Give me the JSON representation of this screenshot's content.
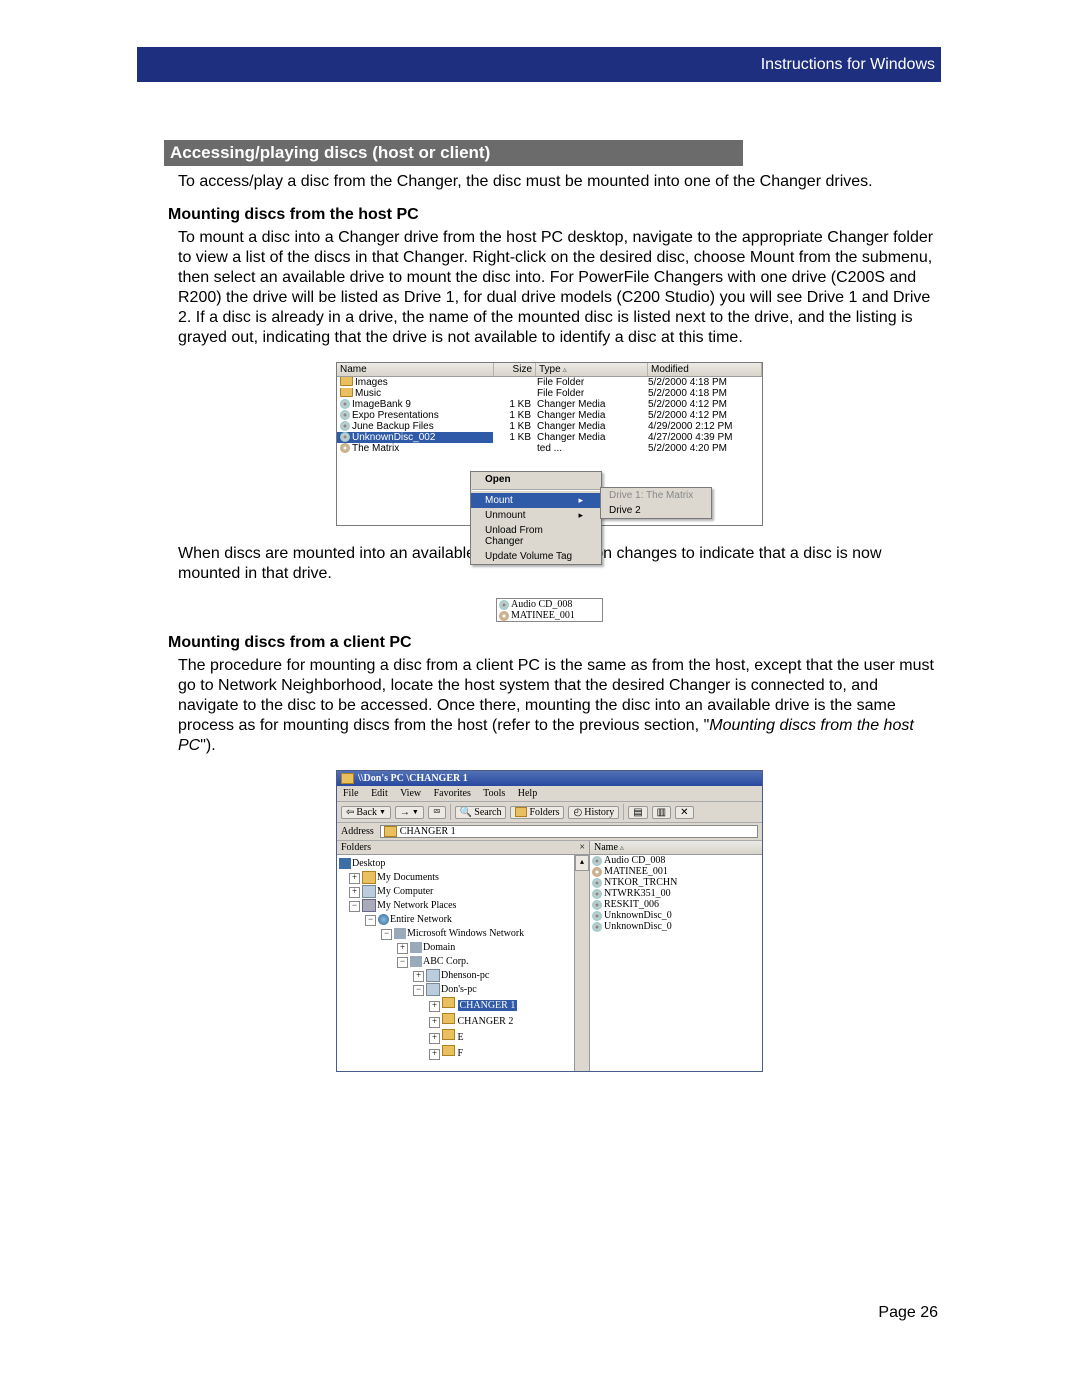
{
  "header": {
    "right_text": "Instructions for Windows"
  },
  "section": {
    "title": "Accessing/playing discs (host or client)"
  },
  "para1": "To access/play a disc from the Changer, the disc must be mounted into one of the Changer drives.",
  "sub1": "Mounting discs from the host PC",
  "para2": "To mount a disc into a Changer drive from the host PC desktop, navigate to the appropriate Changer folder to view a list of the discs in that Changer. Right-click on the desired disc, choose Mount from the submenu, then select an available drive to mount the disc into. For PowerFile Changers with one drive (C200S and R200) the drive will be listed as Drive 1, for dual drive models (C200 Studio) you will see Drive 1 and Drive 2. If a disc is already in a drive, the name of the mounted disc is listed next to the drive, and the listing is grayed out, indicating that the drive is not available to identify a disc at this time.",
  "para3": "When discs are mounted into an available drive, the disc icon changes to indicate that a disc is now mounted in that drive.",
  "sub2": "Mounting discs from a client PC",
  "para4_before": "The procedure for mounting a disc from a client PC is the same as from the host, except that the user must go to Network Neighborhood, locate the host system that the desired Changer is connected to, and navigate to the disc to be accessed. Once there, mounting the disc into an available drive is the same process as for mounting discs from the host (refer to the previous section, \"",
  "para4_em": "Mounting discs from the host PC",
  "para4_after": "\").",
  "footer": {
    "page": "Page 26"
  },
  "filelist": {
    "cols": {
      "name": "Name",
      "size": "Size",
      "type": "Type",
      "modified": "Modified"
    },
    "rows": [
      {
        "icon": "folder",
        "name": "Images",
        "size": "",
        "type": "File Folder",
        "mod": "5/2/2000 4:18 PM"
      },
      {
        "icon": "folder",
        "name": "Music",
        "size": "",
        "type": "File Folder",
        "mod": "5/2/2000 4:18 PM"
      },
      {
        "icon": "disc",
        "name": "ImageBank 9",
        "size": "1 KB",
        "type": "Changer Media",
        "mod": "5/2/2000 4:12 PM"
      },
      {
        "icon": "disc",
        "name": "Expo Presentations",
        "size": "1 KB",
        "type": "Changer Media",
        "mod": "5/2/2000 4:12 PM"
      },
      {
        "icon": "disc",
        "name": "June Backup Files",
        "size": "1 KB",
        "type": "Changer Media",
        "mod": "4/29/2000 2:12 PM"
      },
      {
        "icon": "disc",
        "name": "UnknownDisc_002",
        "size": "1 KB",
        "type": "Changer Media",
        "mod": "4/27/2000 4:39 PM",
        "sel": true
      },
      {
        "icon": "dvd",
        "name": "The Matrix",
        "size": "",
        "type": "ted ...",
        "mod": "5/2/2000 4:20 PM"
      }
    ],
    "ctx": {
      "open": "Open",
      "mount": "Mount",
      "unmount": "Unmount",
      "unload": "Unload From Changer",
      "update": "Update Volume Tag"
    },
    "submenu": {
      "d1": "Drive 1: The Matrix",
      "d2": "Drive 2"
    }
  },
  "iconpair": {
    "a": "Audio CD_008",
    "b": "MATINEE_001"
  },
  "explorer": {
    "title": "\\\\Don's PC \\CHANGER 1",
    "menu": [
      "File",
      "Edit",
      "View",
      "Favorites",
      "Tools",
      "Help"
    ],
    "tb": {
      "back": "Back",
      "search": "Search",
      "folders": "Folders",
      "history": "History"
    },
    "addr_label": "Address",
    "addr_value": "CHANGER 1",
    "folders_label": "Folders",
    "tree": {
      "desktop": "Desktop",
      "mydoc": "My Documents",
      "mycomp": "My Computer",
      "mynet": "My Network Places",
      "entire": "Entire Network",
      "mswn": "Microsoft Windows Network",
      "domain": "Domain",
      "abc": "ABC Corp.",
      "dhenson": "Dhenson-pc",
      "dons": "Don's-pc",
      "ch1": "CHANGER 1",
      "ch2": "CHANGER 2",
      "e": "E",
      "f": "F"
    },
    "list_hdr": "Name",
    "list": [
      {
        "icon": "disc",
        "name": "Audio CD_008"
      },
      {
        "icon": "dvd",
        "name": "MATINEE_001"
      },
      {
        "icon": "disc",
        "name": "NTKOR_TRCHN"
      },
      {
        "icon": "disc",
        "name": "NTWRK351_00"
      },
      {
        "icon": "disc",
        "name": "RESKIT_006"
      },
      {
        "icon": "disc",
        "name": "UnknownDisc_0"
      },
      {
        "icon": "disc",
        "name": "UnknownDisc_0"
      }
    ]
  }
}
